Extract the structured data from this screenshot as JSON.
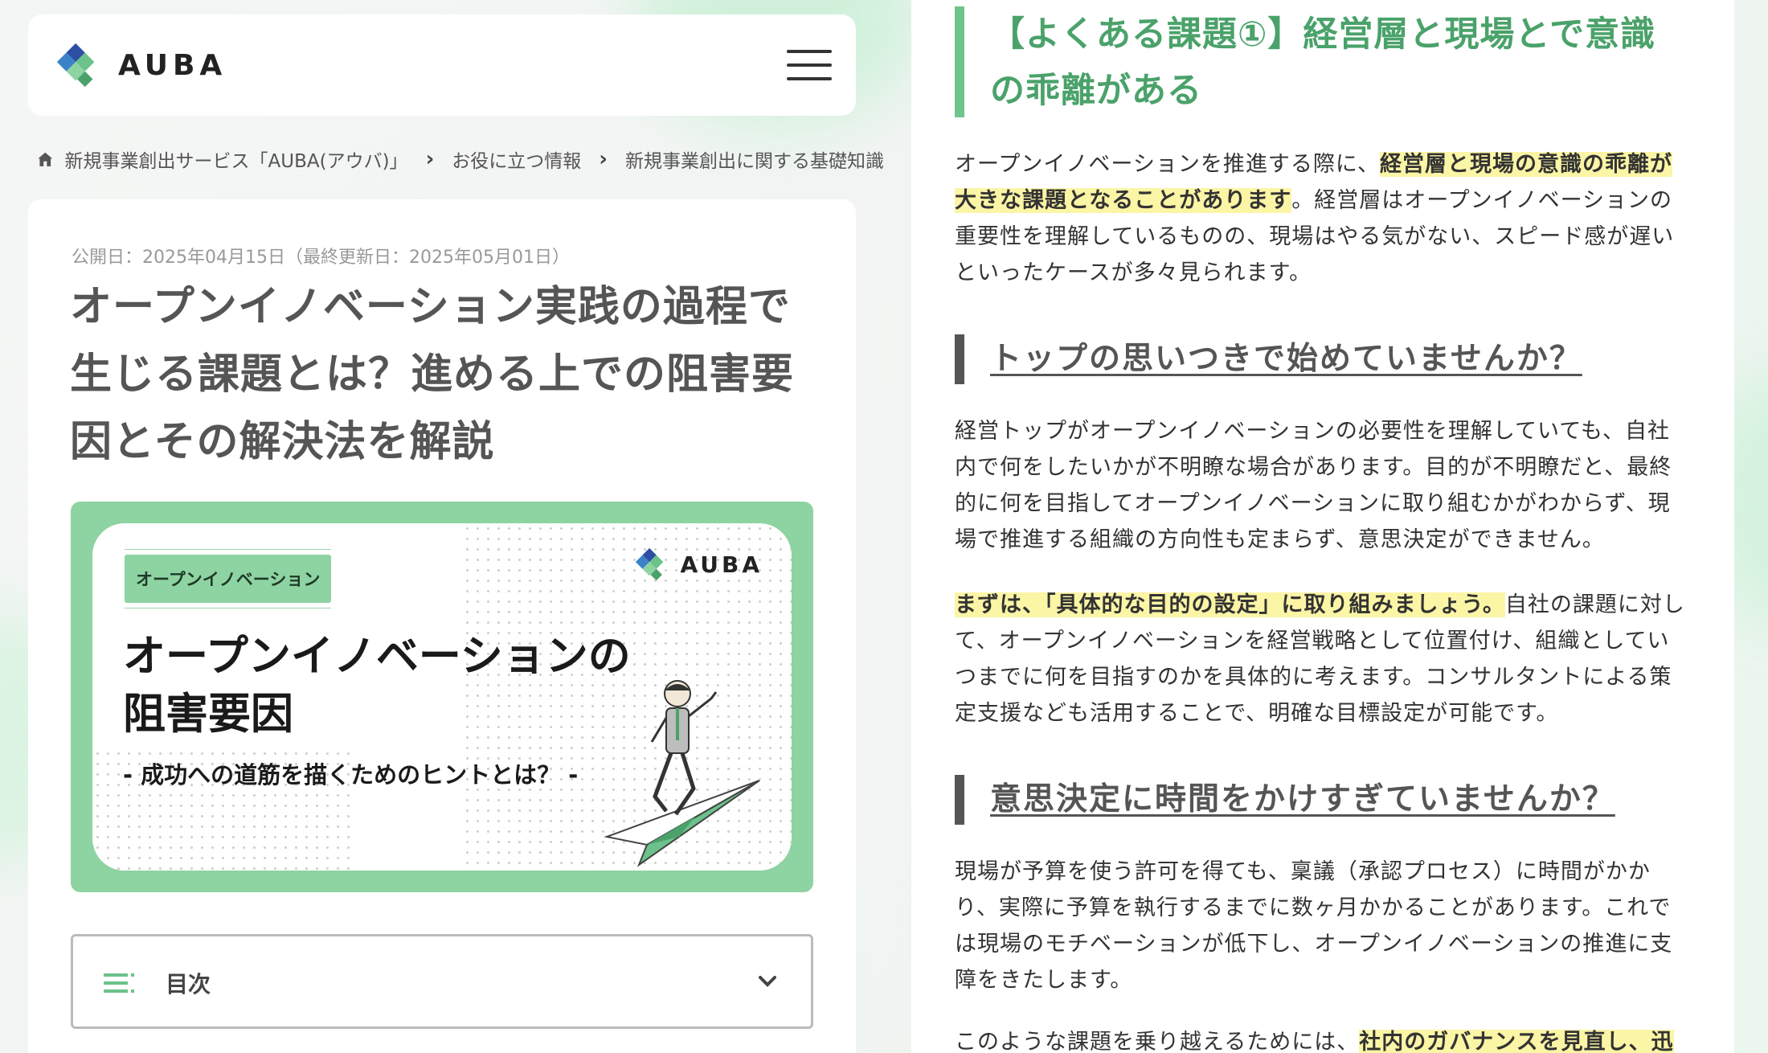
{
  "header": {
    "brand": "AUBA",
    "menu_icon": "hamburger-menu-icon"
  },
  "breadcrumb": {
    "home_icon": "home-icon",
    "items": [
      "新規事業創出サービス「AUBA(アウバ)」",
      "お役に立つ情報",
      "新規事業創出に関する基礎知識"
    ]
  },
  "article": {
    "date": "公開日：2025年04月15日（最終更新日：2025年05月01日）",
    "title": "オープンイノベーション実践の過程で生じる課題とは？進める上での阻害要因とその解決法を解説"
  },
  "hero": {
    "tag": "オープンイノベーション",
    "brand": "AUBA",
    "title_line1": "オープンイノベーションの",
    "title_line2": "阻害要因",
    "subtitle": "- 成功への道筋を描くためのヒントとは？ -"
  },
  "toc": {
    "label": "目次",
    "icon": "list-icon",
    "chevron": "chevron-down-icon"
  },
  "content": {
    "h2_line1": "【よくある課題①】経営層と現場とで意識",
    "h2_line2": "の乖離がある",
    "p1_pre": "オープンイノベーションを推進する際に、",
    "p1_mark": "経営層と現場の意識の乖離が大きな課題となることがあります",
    "p1_post": "。経営層はオープンイノベーションの重要性を理解しているものの、現場はやる気がない、スピード感が遅いといったケースが多々見られます。",
    "h3a": "トップの思いつきで始めていませんか？",
    "p2": "経営トップがオープンイノベーションの必要性を理解していても、自社内で何をしたいかが不明瞭な場合があります。目的が不明瞭だと、最終的に何を目指してオープンイノベーションに取り組むかがわからず、現場で推進する組織の方向性も定まらず、意思決定ができません。",
    "p3_mark": "まずは、「具体的な目的の設定」に取り組みましょう。",
    "p3_post": "自社の課題に対して、オープンイノベーションを経営戦略として位置付け、組織としていつまでに何を目指すのかを具体的に考えます。コンサルタントによる策定支援なども活用することで、明確な目標設定が可能です。",
    "h3b": "意思決定に時間をかけすぎていませんか？",
    "p4": "現場が予算を使う許可を得ても、稟議（承認プロセス）に時間がかかり、実際に予算を執行するまでに数ヶ月かかることがあります。これでは現場のモチベーションが低下し、オープンイノベーションの推進に支障をきたします。",
    "p5_pre": "このような課題を乗り越えるためには、",
    "p5_mark": "社内のガバナンスを見直し、迅"
  },
  "colors": {
    "accent_green": "#8ed3a2",
    "heading_green": "#4aa26a",
    "highlight": "#fbf5a6"
  }
}
